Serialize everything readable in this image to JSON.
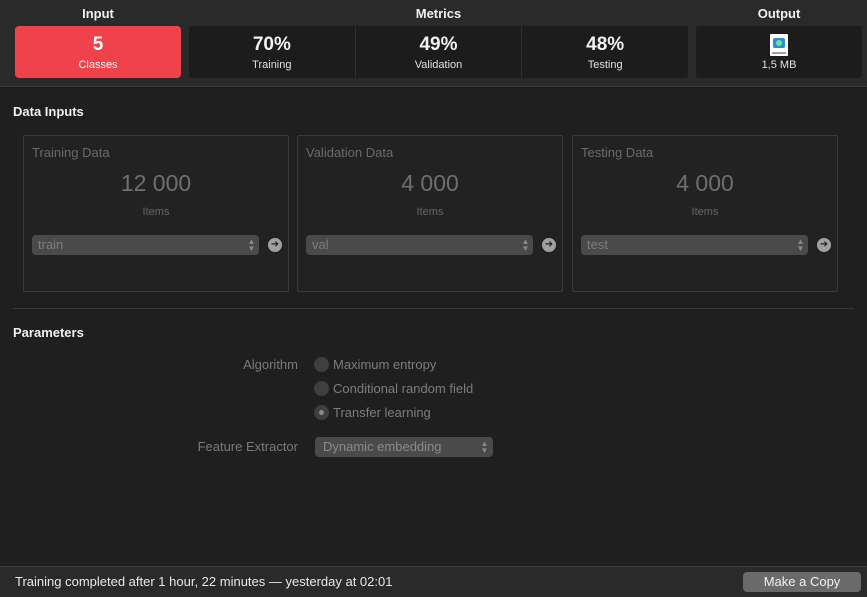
{
  "summary": {
    "input": {
      "title": "Input",
      "value": "5",
      "caption": "Classes",
      "color": "#f0424a"
    },
    "metrics": {
      "title": "Metrics",
      "items": [
        {
          "value": "70%",
          "caption": "Training"
        },
        {
          "value": "49%",
          "caption": "Validation"
        },
        {
          "value": "48%",
          "caption": "Testing"
        }
      ]
    },
    "output": {
      "title": "Output",
      "icon": "ml-model-file-icon",
      "caption": "1,5 MB"
    }
  },
  "data_inputs": {
    "heading": "Data Inputs",
    "cards": [
      {
        "title": "Training Data",
        "count": "12 000",
        "unit": "Items",
        "source": "train"
      },
      {
        "title": "Validation Data",
        "count": "4 000",
        "unit": "Items",
        "source": "val"
      },
      {
        "title": "Testing Data",
        "count": "4 000",
        "unit": "Items",
        "source": "test"
      }
    ]
  },
  "parameters": {
    "heading": "Parameters",
    "algorithm_label": "Algorithm",
    "algorithm_options": [
      {
        "label": "Maximum entropy",
        "checked": false
      },
      {
        "label": "Conditional random field",
        "checked": false
      },
      {
        "label": "Transfer learning",
        "checked": true
      }
    ],
    "feature_extractor_label": "Feature Extractor",
    "feature_extractor_value": "Dynamic embedding"
  },
  "status": {
    "text": "Training completed after 1 hour, 22 minutes — yesterday at 02:01",
    "button_label": "Make a Copy"
  }
}
